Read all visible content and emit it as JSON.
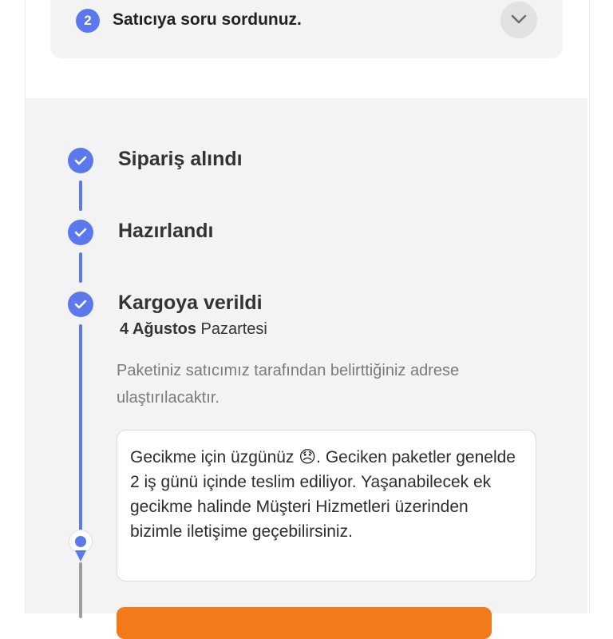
{
  "question": {
    "step_number": "2",
    "text": "Satıcıya soru sordunuz.",
    "toggle_icon": "chevron-down-icon"
  },
  "timeline": {
    "steps": [
      {
        "title": "Sipariş alındı",
        "status": "done"
      },
      {
        "title": "Hazırlandı",
        "status": "done"
      },
      {
        "title": "Kargoya verildi",
        "status": "done"
      }
    ],
    "shipping": {
      "date_bold": "4 Ağustos",
      "weekday": "Pazartesi",
      "description": "Paketiniz satıcımız tarafından belirttiğiniz adrese ulaştırılacaktır."
    },
    "notice": "Gecikme için üzgünüz 😞. Geciken paketler genelde 2 iş günü içinde teslim ediliyor. Yaşanabilecek ek gecikme halinde Müşteri Hizmetleri üzerinden bizimle iletişime geçebilirsiniz."
  },
  "colors": {
    "accent": "#5b78ee",
    "action": "#f27a1a",
    "panel": "#f3f3f3"
  }
}
